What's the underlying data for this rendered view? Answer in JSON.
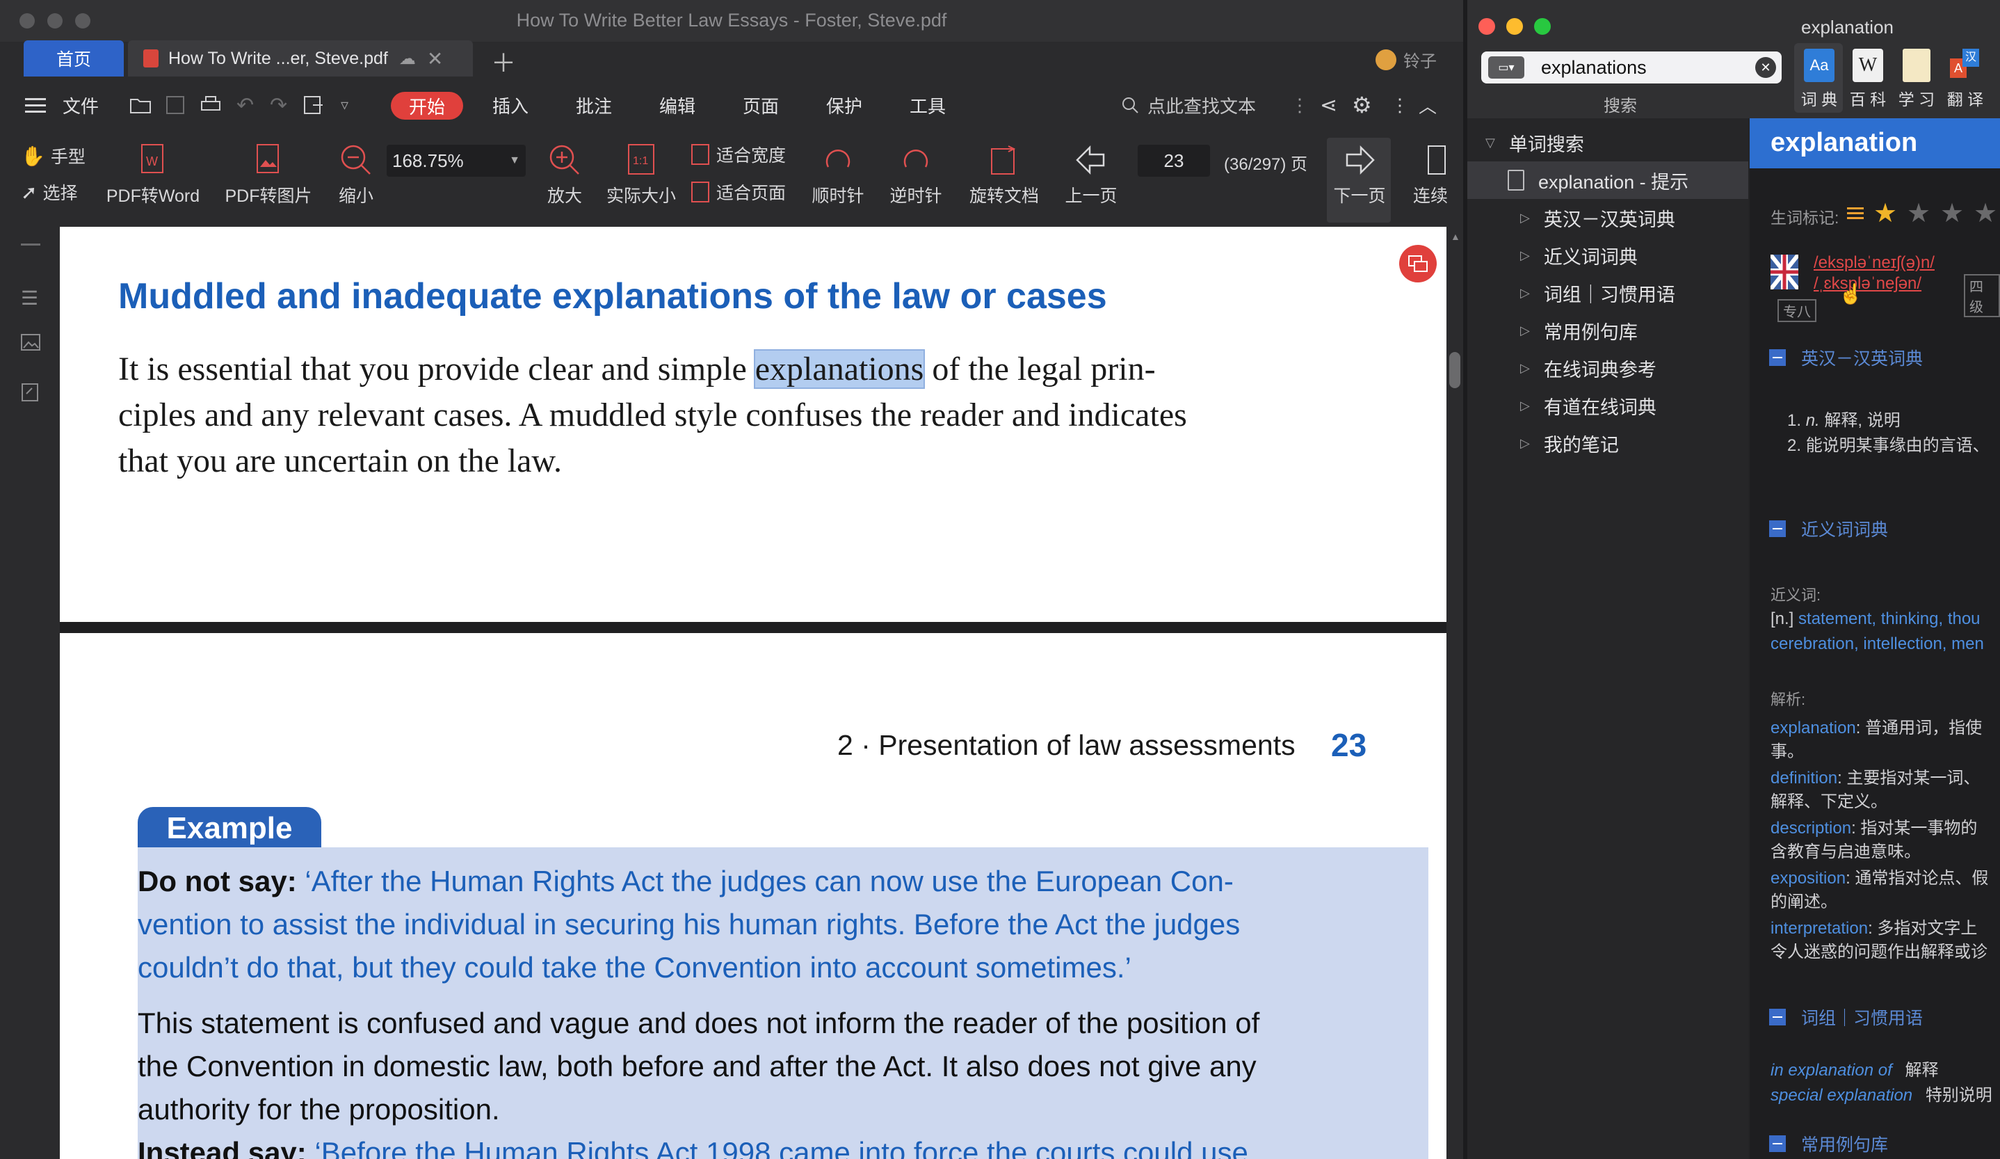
{
  "pdf_window": {
    "title": "How To Write Better Law Essays - Foster, Steve.pdf",
    "tabs": {
      "home": "首页",
      "document": "How To Write ...er, Steve.pdf"
    },
    "user": "铃子",
    "menu": {
      "file": "文件",
      "start": "开始",
      "insert": "插入",
      "annotate": "批注",
      "edit": "编辑",
      "page": "页面",
      "protect": "保护",
      "tools": "工具",
      "search_text": "点此查找文本"
    },
    "toolbar": {
      "hand": "手型",
      "select": "选择",
      "pdf_to_word": "PDF转Word",
      "pdf_to_image": "PDF转图片",
      "zoom_out": "缩小",
      "zoom_value": "168.75%",
      "zoom_in": "放大",
      "actual_size": "实际大小",
      "fit_width": "适合宽度",
      "fit_page": "适合页面",
      "rotate_cw": "顺时针",
      "rotate_ccw": "逆时针",
      "rotate_doc": "旋转文档",
      "prev_page": "上一页",
      "page_number": "23",
      "page_info": "(36/297) 页",
      "next_page": "下一页",
      "continuous": "连续"
    },
    "page1": {
      "heading": "Muddled and inadequate explanations of the law or cases",
      "para_line1_before": "It is essential that you provide clear and simple",
      "para_highlight": "explanations",
      "para_line1_after": "of the legal prin-",
      "para_line2": "ciples and any relevant cases. A muddled style confuses the reader and indicates",
      "para_line3": "that you are uncertain on the law."
    },
    "page2": {
      "running_head": "2 · Presentation of law assessments",
      "page_no": "23",
      "example_tab": "Example",
      "do_not_say_label": "Do not say:",
      "quote_line1": "‘After the Human Rights Act the judges can now use the European Con-",
      "quote_line2": "vention to assist the individual in securing his human rights. Before the Act the judges",
      "quote_line3": "couldn’t do that, but they could take the Convention into account sometimes.’",
      "body_line1": "This statement is confused and vague and does not inform the reader of the position of",
      "body_line2": "the Convention in domestic law, both before and after the Act. It also does not give any",
      "body_line3": "authority for the proposition.",
      "instead_label": "Instead say:",
      "instead_text": "‘Before the Human Rights Act 1998 came into force the courts could use"
    }
  },
  "dict_window": {
    "title": "explanation",
    "search_value": "explanations",
    "search_label": "搜索",
    "tabs": [
      "词 典",
      "百 科",
      "学 习",
      "翻 译"
    ],
    "tree": {
      "root": "单词搜索",
      "selected": "explanation - 提示",
      "items": [
        "英汉－汉英词典",
        "近义词词典",
        "词组｜习惯用语",
        "常用例句库",
        "在线词典参考",
        "有道在线词典",
        "我的笔记"
      ]
    },
    "content": {
      "word": "explanation",
      "vocab_mark": "生词标记:",
      "phonetic_uk": "/ekspləˈneɪʃ(ə)n/",
      "phonetic_us": "/ˌɛkspləˈneʃən/",
      "level_tag": "四级",
      "tag2": "专八",
      "section_ec": "英汉－汉英词典",
      "def1_num": "1.",
      "def1_pos": "n.",
      "def1": "解释, 说明",
      "def2_num": "2.",
      "def2": "能说明某事缘由的言语、",
      "section_syn": "近义词词典",
      "syn_label": "近义词:",
      "syn_pos": "[n.]",
      "syn_line1": "statement, thinking, thou",
      "syn_line2": "cerebration, intellection, men",
      "analysis_label": "解析:",
      "an1_word": "explanation",
      "an1_text": ": 普通用词，指使",
      "an1_cont": "事。",
      "an2_word": "definition",
      "an2_text": ": 主要指对某一词、",
      "an2_cont": "解释、下定义。",
      "an3_word": "description",
      "an3_text": ": 指对某一事物的",
      "an3_cont": "含教育与启迪意味。",
      "an4_word": "exposition",
      "an4_text": ": 通常指对论点、假",
      "an4_cont": "的阐述。",
      "an5_word": "interpretation",
      "an5_text": ": 多指对文字上",
      "an5_cont": "令人迷惑的问题作出解释或诊",
      "section_phrase": "词组｜习惯用语",
      "phrase1": "in explanation of",
      "phrase1_def": "解释",
      "phrase2": "special explanation",
      "phrase2_def": "特别说明",
      "section_sent": "常用例句库"
    }
  },
  "colors": {
    "accent_blue": "#2e63c8",
    "heading_blue": "#1b5fb8",
    "highlight": "#b3cdf0",
    "example_bg": "#cdd8ef",
    "start_red": "#e0403c",
    "star": "#f0b429"
  }
}
